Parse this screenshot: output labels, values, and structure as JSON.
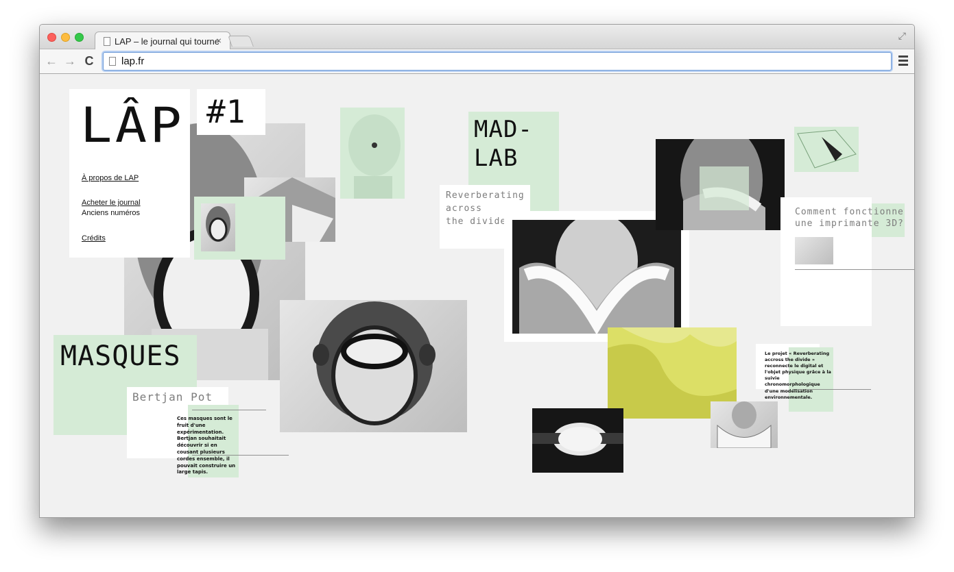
{
  "browser": {
    "tab_title": "LAP – le journal qui tourne",
    "tab_close": "×",
    "url": "lap.fr",
    "back": "←",
    "forward": "→",
    "reload": "C",
    "fullscreen": "⤢"
  },
  "site": {
    "logo": "LÂP",
    "issue": "#1",
    "nav": {
      "about": "À propos de LAP",
      "buy": "Acheter le journal",
      "back_issues": "Anciens numéros",
      "credits": "Crédits"
    },
    "masques": {
      "title": "MASQUES",
      "author": "Bertjan Pot",
      "lead": "Ces masques sont le fruit d'une expérimentation. Bertjan souhaitait découvrir si en cousant plusieurs cordes ensemble, il pouvait construire un large tapis."
    },
    "madlab": {
      "title_line1": "MAD-",
      "title_line2": "LAB",
      "subtitle_line1": "Reverberating",
      "subtitle_line2": "across",
      "subtitle_line3": "the divide",
      "caption": "Le projet « Reverberating accross the divide » reconnecte le digital et l'objet physique grâce à la suivie chronomorphologique d'une modélisation environnementale."
    },
    "printer": {
      "title": "Comment fonctionne une imprimante 3D?"
    }
  }
}
